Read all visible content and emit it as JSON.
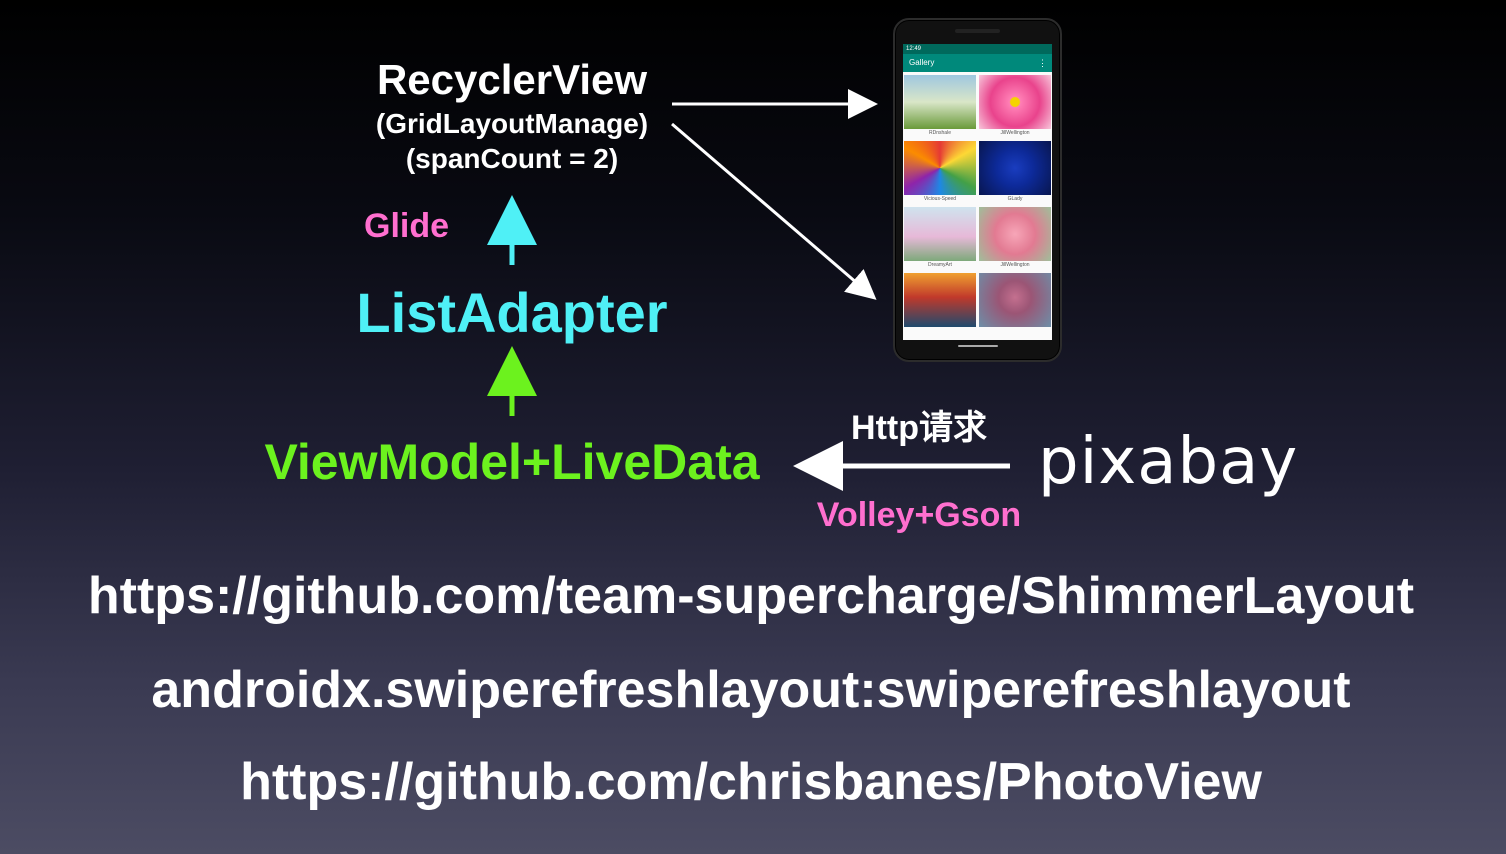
{
  "diagram": {
    "recycler_title": "RecyclerView",
    "recycler_sub1": "(GridLayoutManage)",
    "recycler_sub2": "(spanCount = 2)",
    "glide_label": "Glide",
    "list_adapter_label": "ListAdapter",
    "viewmodel_label": "ViewModel+LiveData",
    "http_label": "Http请求",
    "volley_label": "Volley+Gson",
    "pixabay_logo": "pixabay"
  },
  "phone": {
    "status_time": "12:49",
    "app_title": "Gallery",
    "menu_icon": "more-vert-icon",
    "captions": [
      "RDnshale",
      "JillWellington",
      "Vicious-Speed",
      "GLady",
      "DreamyArt",
      "JillWellington",
      "",
      ""
    ]
  },
  "links": {
    "url1": "https://github.com/team-supercharge/ShimmerLayout",
    "url2": "androidx.swiperefreshlayout:swiperefreshlayout",
    "url3": "https://github.com/chrisbanes/PhotoView"
  },
  "colors": {
    "white": "#ffffff",
    "pink": "#ff6fcf",
    "cyan": "#4ff0f6",
    "green": "#6cf21e",
    "teal_toolbar": "#00897b"
  }
}
